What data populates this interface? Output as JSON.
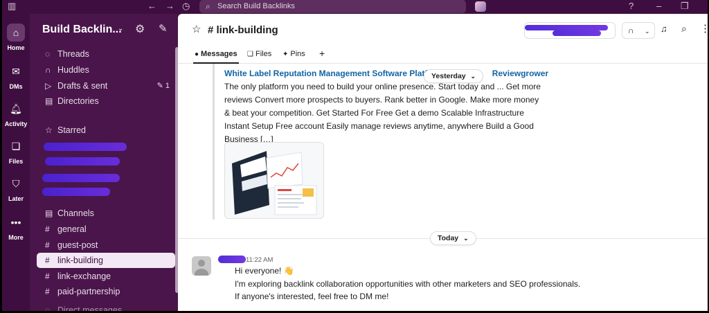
{
  "topbar": {
    "search_placeholder": "Search Build Backlinks",
    "help_icon": "?",
    "minimize_icon": "–",
    "restore_icon": "❐"
  },
  "rail": {
    "home": "Home",
    "dms": "DMs",
    "activity": "Activity",
    "files": "Files",
    "later": "Later",
    "more": "More"
  },
  "sidebar": {
    "workspace": "Build Backlin...",
    "nav": [
      {
        "label": "Threads",
        "icon": "thread-icon"
      },
      {
        "label": "Huddles",
        "icon": "headphones-icon"
      },
      {
        "label": "Drafts & sent",
        "icon": "send-icon",
        "badge": "1"
      },
      {
        "label": "Directories",
        "icon": "directory-icon"
      }
    ],
    "starred_label": "Starred",
    "channels_label": "Channels",
    "channels": [
      "general",
      "guest-post",
      "link-building",
      "link-exchange",
      "paid-partnership"
    ],
    "active_channel": "link-building",
    "direct_label": "Direct messages"
  },
  "header": {
    "channel_name": "# link-building"
  },
  "tabs": [
    {
      "label": "Messages",
      "icon": "message-icon"
    },
    {
      "label": "Files",
      "icon": "file-icon"
    },
    {
      "label": "Pins",
      "icon": "pin-icon"
    },
    {
      "label": "+",
      "icon": "plus-icon"
    }
  ],
  "unfurl": {
    "title_left": "White Label Reputation Management Software Platfor",
    "title_right": "Reviewgrower",
    "description": "The only platform you need to build your online presence. Start today and ... Get more reviews Convert more prospects to buyers. Rank better in Google. Make more money & beat your competition. Get Started For Free Get a demo Scalable Infrastructure Instant Setup Free account Easily manage reviews anytime, anywhere Build a Good Business […]"
  },
  "dates": {
    "yesterday": "Yesterday",
    "today": "Today"
  },
  "message": {
    "time": "11:22 AM",
    "line1": "Hi everyone! 👋",
    "line2": "I'm exploring backlink collaboration opportunities with other marketers and SEO professionals.",
    "line3": "If anyone's interested, feel free to DM me!"
  },
  "colors": {
    "aubergine": "#4a154b",
    "link": "#1264a3",
    "redaction": "#4b22d6"
  }
}
